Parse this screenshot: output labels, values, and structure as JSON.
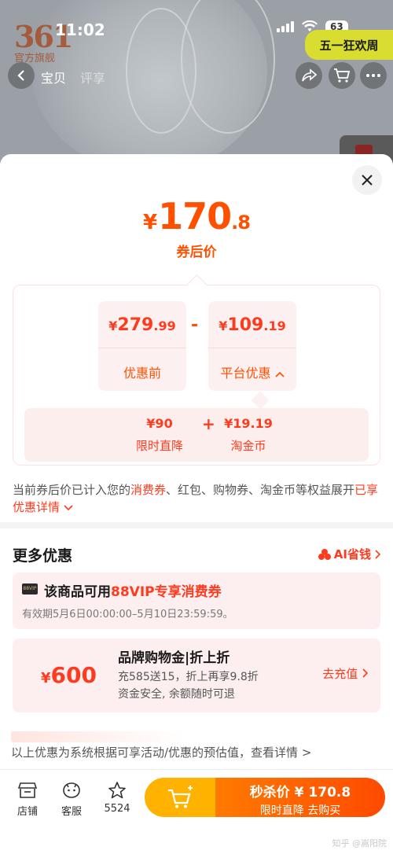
{
  "status_bar": {
    "time": "11:02",
    "battery": "63"
  },
  "brand": {
    "logo_number": "361",
    "logo_text": "官方旗舰"
  },
  "header": {
    "promo_badge": "五一狂欢周",
    "tabs": [
      "宝贝",
      "评享"
    ]
  },
  "sheet": {
    "price_yen": "¥",
    "price_int": "170",
    "price_dec": ".8",
    "price_label": "券后价",
    "original": {
      "yen": "¥",
      "int": "279",
      "dec": ".99",
      "label": "优惠前"
    },
    "minus": "-",
    "discount": {
      "yen": "¥",
      "int": "109",
      "dec": ".19",
      "label": "平台优惠"
    },
    "sub": {
      "limit": {
        "value": "¥90",
        "label": "限时直降"
      },
      "plus": "+",
      "coin": {
        "value": "¥19.19",
        "label": "淘金币"
      }
    },
    "note": {
      "p1": "当前券后价已计入您的",
      "hl1": "消费券",
      "p2": "、红包、购物券、淘金币等权益展开",
      "hl2": "已享优惠详情"
    }
  },
  "more": {
    "title": "更多优惠",
    "ai_link": "AI省钱",
    "vip": {
      "tag": "88VIP",
      "title_prefix": "该商品可用",
      "title_hl": "88VIP专享消费券",
      "subtitle": "有效期5月6日00:00:00–5月10日23:59:59。"
    },
    "gold": {
      "yen": "¥",
      "amount": "600",
      "title": "品牌购物金|折上折",
      "line1": "充585送15，折上再享9.8折",
      "line2": "资金安全, 余额随时可退",
      "action": "去充值"
    },
    "estimate": "以上优惠为系统根据可享活动/优惠的预估值，查看详情 >"
  },
  "bottom": {
    "shop": "店铺",
    "service": "客服",
    "favorites": "5524",
    "buy_title": "秒杀价 ¥ 170.8",
    "buy_sub": "限时直降  去购买"
  },
  "watermark": "知乎 @嵩阳院",
  "colors": {
    "accent": "#ff5000",
    "red": "#ff3b1f",
    "promo": "#d8dd2f",
    "cart": "#ffb300"
  }
}
